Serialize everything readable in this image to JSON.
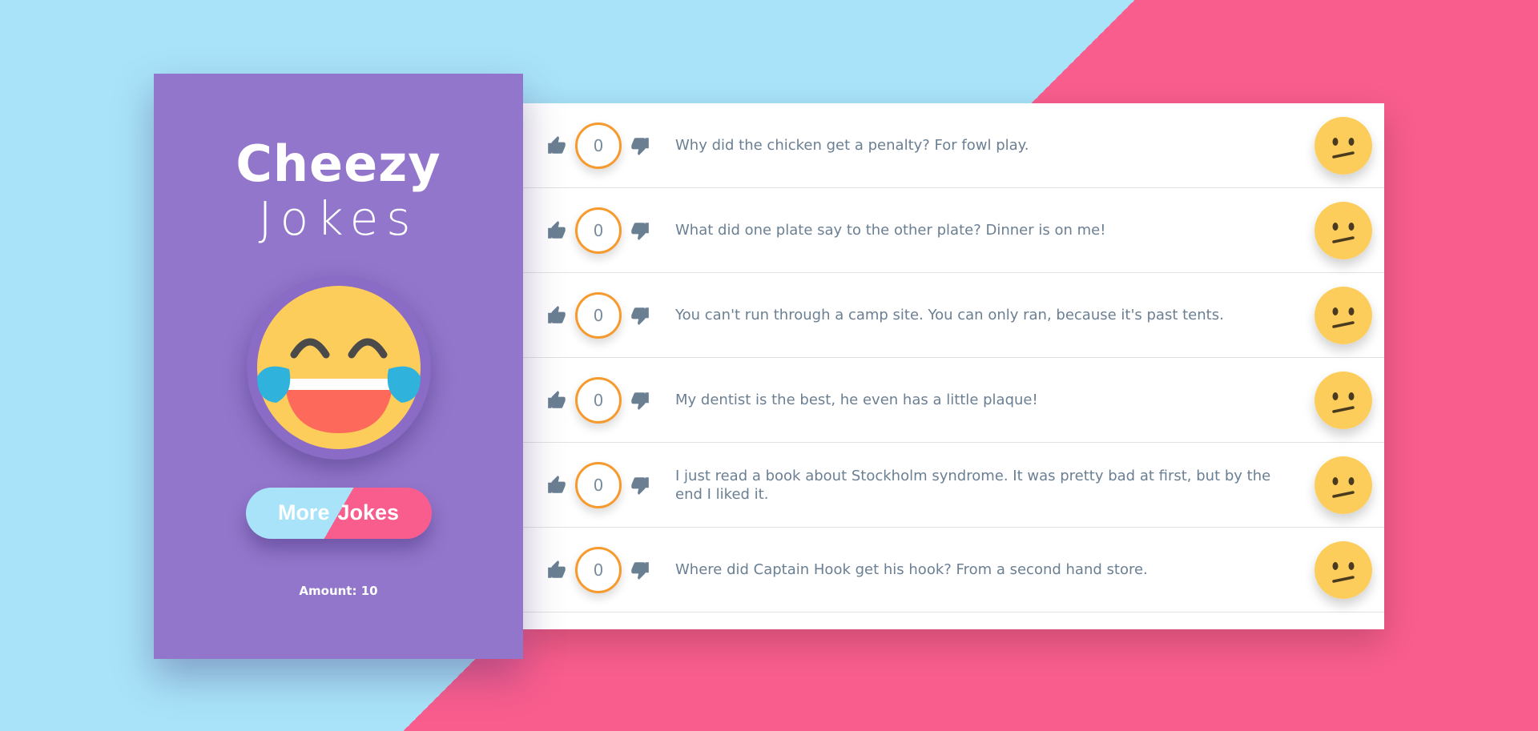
{
  "sidebar": {
    "title_top": "Cheezy",
    "title_bottom": "Jokes",
    "button_label_left": "More",
    "button_label_right": "Jokes",
    "amount": "Amount: 10"
  },
  "colors": {
    "background_left": "#a8e3f9",
    "background_right": "#f85d8d",
    "sidebar": "#9276cb",
    "score_ring": "#f79a2e",
    "emoji_face": "#fdcd5b",
    "text": "#6b7f93"
  },
  "jokes": [
    {
      "score": "0",
      "text": "Why did the chicken get a penalty? For fowl play.",
      "reaction": "confused-face-icon"
    },
    {
      "score": "0",
      "text": "What did one plate say to the other plate? Dinner is on me!",
      "reaction": "confused-face-icon"
    },
    {
      "score": "0",
      "text": "You can't run through a camp site. You can only ran, because it's past tents.",
      "reaction": "confused-face-icon"
    },
    {
      "score": "0",
      "text": "My dentist is the best, he even has a little plaque!",
      "reaction": "confused-face-icon"
    },
    {
      "score": "0",
      "text": "I just read a book about Stockholm syndrome. It was pretty bad at first, but by the end I liked it.",
      "reaction": "confused-face-icon"
    },
    {
      "score": "0",
      "text": "Where did Captain Hook get his hook? From a second hand store.",
      "reaction": "confused-face-icon"
    }
  ]
}
